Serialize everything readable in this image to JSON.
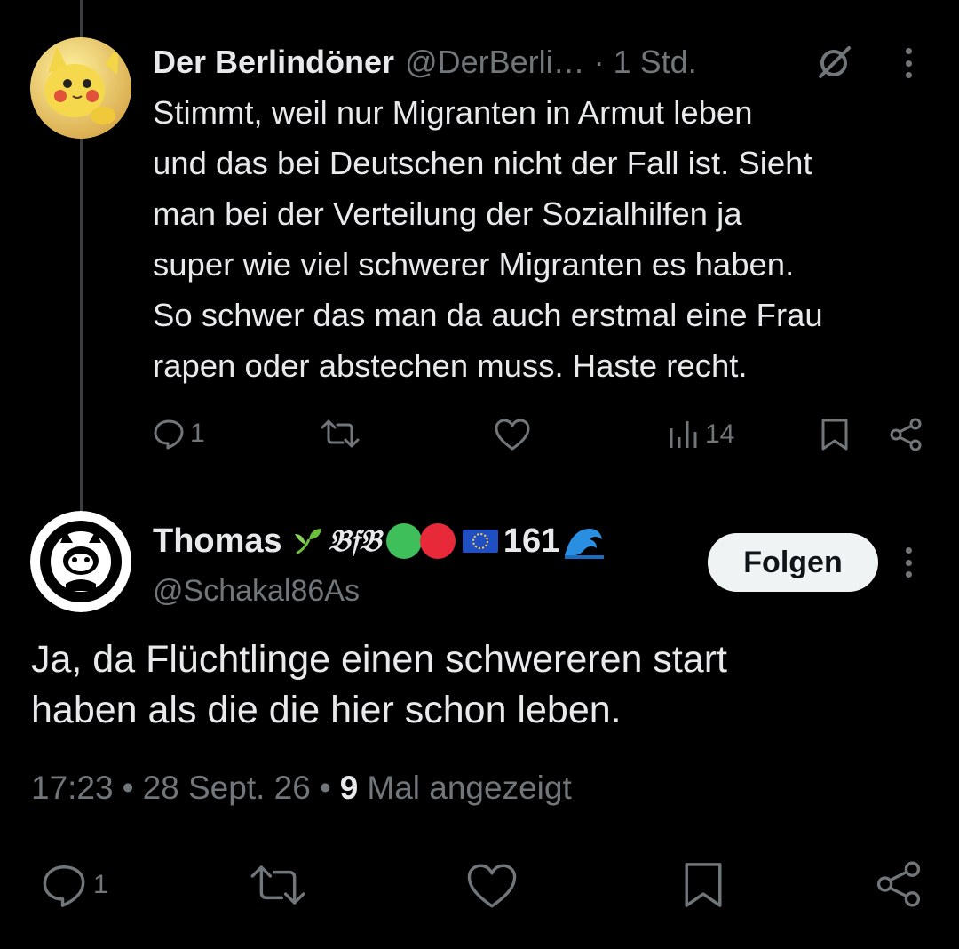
{
  "reply": {
    "author": {
      "display_name": "Der Berlindöner",
      "handle": "@DerBerli…",
      "time": "· 1 Std.",
      "avatar": "pikachu-avatar"
    },
    "text_lines": [
      "Stimmt, weil nur Migranten in Armut leben",
      "und das bei Deutschen nicht der Fall ist. Sieht",
      "man bei der Verteilung der Sozialhilfen ja",
      "super wie viel schwerer Migranten es haben.",
      "So schwer das man da auch erstmal eine Frau",
      "rapen oder abstechen muss. Haste recht."
    ],
    "actions": {
      "reply_count": "1",
      "views_count": "14"
    }
  },
  "main_post": {
    "author": {
      "display_name": "Thomas",
      "badge_text": "𝔅𝔣𝔅",
      "badge_number": "161",
      "handle": "@Schakal86As",
      "avatar": "adhs-antifa-avatar"
    },
    "follow_label": "Folgen",
    "text_lines": [
      "Ja, da Flüchtlinge einen schwereren start",
      "haben als die die hier schon leben."
    ],
    "meta": {
      "time": "17:23",
      "date": "28 Sept. 26",
      "separator": "•",
      "views_count": "9",
      "views_label": "Mal angezeigt"
    },
    "actions": {
      "reply_count": "1"
    }
  },
  "colors": {
    "background": "#000000",
    "text": "#e7e9ea",
    "secondary": "#71767b",
    "follow_bg": "#eff3f4"
  }
}
